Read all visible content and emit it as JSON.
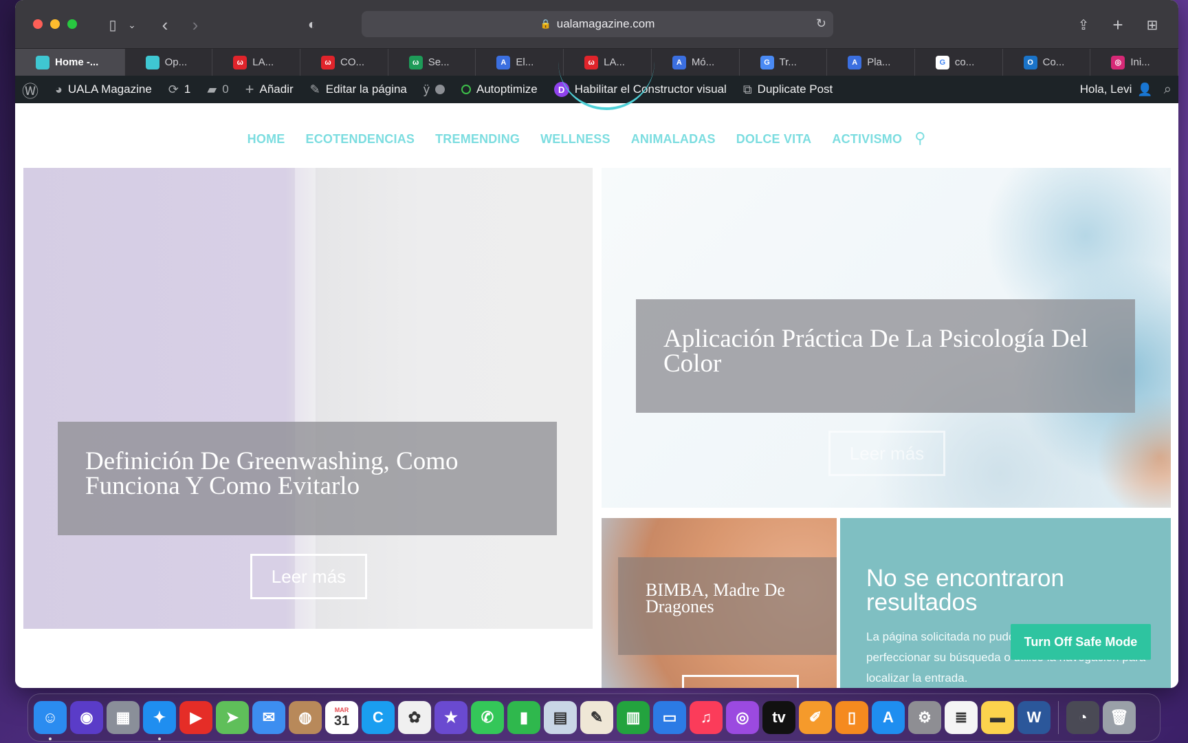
{
  "browser": {
    "url": "ualamagazine.com",
    "tabs": [
      {
        "label": "Home -...",
        "fav": "#3fc7d2",
        "glyph": "",
        "active": true
      },
      {
        "label": "Op...",
        "fav": "#3fc7d2",
        "glyph": ""
      },
      {
        "label": "LA...",
        "fav": "#e0242b",
        "glyph": "ω"
      },
      {
        "label": "CO...",
        "fav": "#e0242b",
        "glyph": "ω"
      },
      {
        "label": "Se...",
        "fav": "#1e9b58",
        "glyph": "ω"
      },
      {
        "label": "El...",
        "fav": "#3b6fe0",
        "glyph": "A"
      },
      {
        "label": "LA...",
        "fav": "#e0242b",
        "glyph": "ω"
      },
      {
        "label": "Mó...",
        "fav": "#3b6fe0",
        "glyph": "A"
      },
      {
        "label": "Tr...",
        "fav": "#4a8af4",
        "glyph": "G"
      },
      {
        "label": "Pla...",
        "fav": "#3b6fe0",
        "glyph": "A"
      },
      {
        "label": "co...",
        "fav": "#ffffff",
        "glyph": "G"
      },
      {
        "label": "Co...",
        "fav": "#1a73c8",
        "glyph": "O"
      },
      {
        "label": "Ini...",
        "fav": "#d62976",
        "glyph": "◎"
      }
    ]
  },
  "adminbar": {
    "site_name": "UALA Magazine",
    "updates": "1",
    "comments": "0",
    "add": "Añadir",
    "edit": "Editar la página",
    "autoptimize": "Autoptimize",
    "divi": "D",
    "visual_builder": "Habilitar el Constructor visual",
    "duplicate": "Duplicate Post",
    "greeting": "Hola, Levi"
  },
  "nav": {
    "items": [
      "HOME",
      "ECOTENDENCIAS",
      "TREMENDING",
      "WELLNESS",
      "ANIMALADAS",
      "DOLCE VITA",
      "ACTIVISMO"
    ]
  },
  "posts": {
    "p1": {
      "title": "Definición De Greenwashing, Como Funciona Y Como Evitarlo",
      "button": "Leer más"
    },
    "p2": {
      "title": "Aplicación Práctica De La Psicología Del Color",
      "button": "Leer más"
    },
    "p3": {
      "title": "BIMBA, Madre De Dragones"
    }
  },
  "empty": {
    "heading": "No se encontraron resultados",
    "text": "La página solicitada no pudo encontrarse. Trate de perfeccionar su búsqueda o utilice la navegación para localizar la entrada."
  },
  "safe_mode": "Turn Off Safe Mode",
  "calendar": {
    "month": "MAR",
    "day": "31"
  },
  "dock": [
    {
      "name": "finder",
      "bg": "#2b8cf0",
      "glyph": "☺",
      "run": true
    },
    {
      "name": "siri",
      "bg": "#5a3cc8",
      "glyph": "◉"
    },
    {
      "name": "launchpad",
      "bg": "#8a8f99",
      "glyph": "▦"
    },
    {
      "name": "safari",
      "bg": "#1f8ef0",
      "glyph": "✦",
      "run": true
    },
    {
      "name": "youtube",
      "bg": "#e52d27",
      "glyph": "▶"
    },
    {
      "name": "maps",
      "bg": "#5fbf5a",
      "glyph": "➤"
    },
    {
      "name": "mail",
      "bg": "#3d8ef0",
      "glyph": "✉"
    },
    {
      "name": "contacts",
      "bg": "#b8895a",
      "glyph": "◍"
    },
    {
      "name": "calendar",
      "bg": "#ffffff",
      "glyph": "31"
    },
    {
      "name": "canva",
      "bg": "#1a9ef0",
      "glyph": "C"
    },
    {
      "name": "photos",
      "bg": "#f0f0f0",
      "glyph": "✿"
    },
    {
      "name": "imovie",
      "bg": "#6a4ad0",
      "glyph": "★"
    },
    {
      "name": "messages",
      "bg": "#34c759",
      "glyph": "✆"
    },
    {
      "name": "facetime",
      "bg": "#2fb84d",
      "glyph": "▮"
    },
    {
      "name": "preview",
      "bg": "#c9d6e6",
      "glyph": "▤"
    },
    {
      "name": "textedit",
      "bg": "#efe7d6",
      "glyph": "✎"
    },
    {
      "name": "numbers",
      "bg": "#23a33e",
      "glyph": "▥"
    },
    {
      "name": "keynote",
      "bg": "#2c7be5",
      "glyph": "▭"
    },
    {
      "name": "music",
      "bg": "#fb3c5a",
      "glyph": "♫"
    },
    {
      "name": "podcasts",
      "bg": "#9b4ae0",
      "glyph": "◎"
    },
    {
      "name": "appletv",
      "bg": "#111111",
      "glyph": "tv"
    },
    {
      "name": "pages",
      "bg": "#f59a2b",
      "glyph": "✐"
    },
    {
      "name": "books",
      "bg": "#f58a1f",
      "glyph": "▯"
    },
    {
      "name": "appstore",
      "bg": "#1f8ef0",
      "glyph": "A"
    },
    {
      "name": "settings",
      "bg": "#8e8e93",
      "glyph": "⚙"
    },
    {
      "name": "reminders",
      "bg": "#f5f5f5",
      "glyph": "≣"
    },
    {
      "name": "notes",
      "bg": "#fcd34d",
      "glyph": "▬"
    },
    {
      "name": "word",
      "bg": "#2b579a",
      "glyph": "W"
    },
    {
      "name": "quicktime",
      "bg": "#4a4a55",
      "glyph": "◔"
    },
    {
      "name": "trash",
      "bg": "#9aa0a8",
      "glyph": "🗑"
    }
  ]
}
